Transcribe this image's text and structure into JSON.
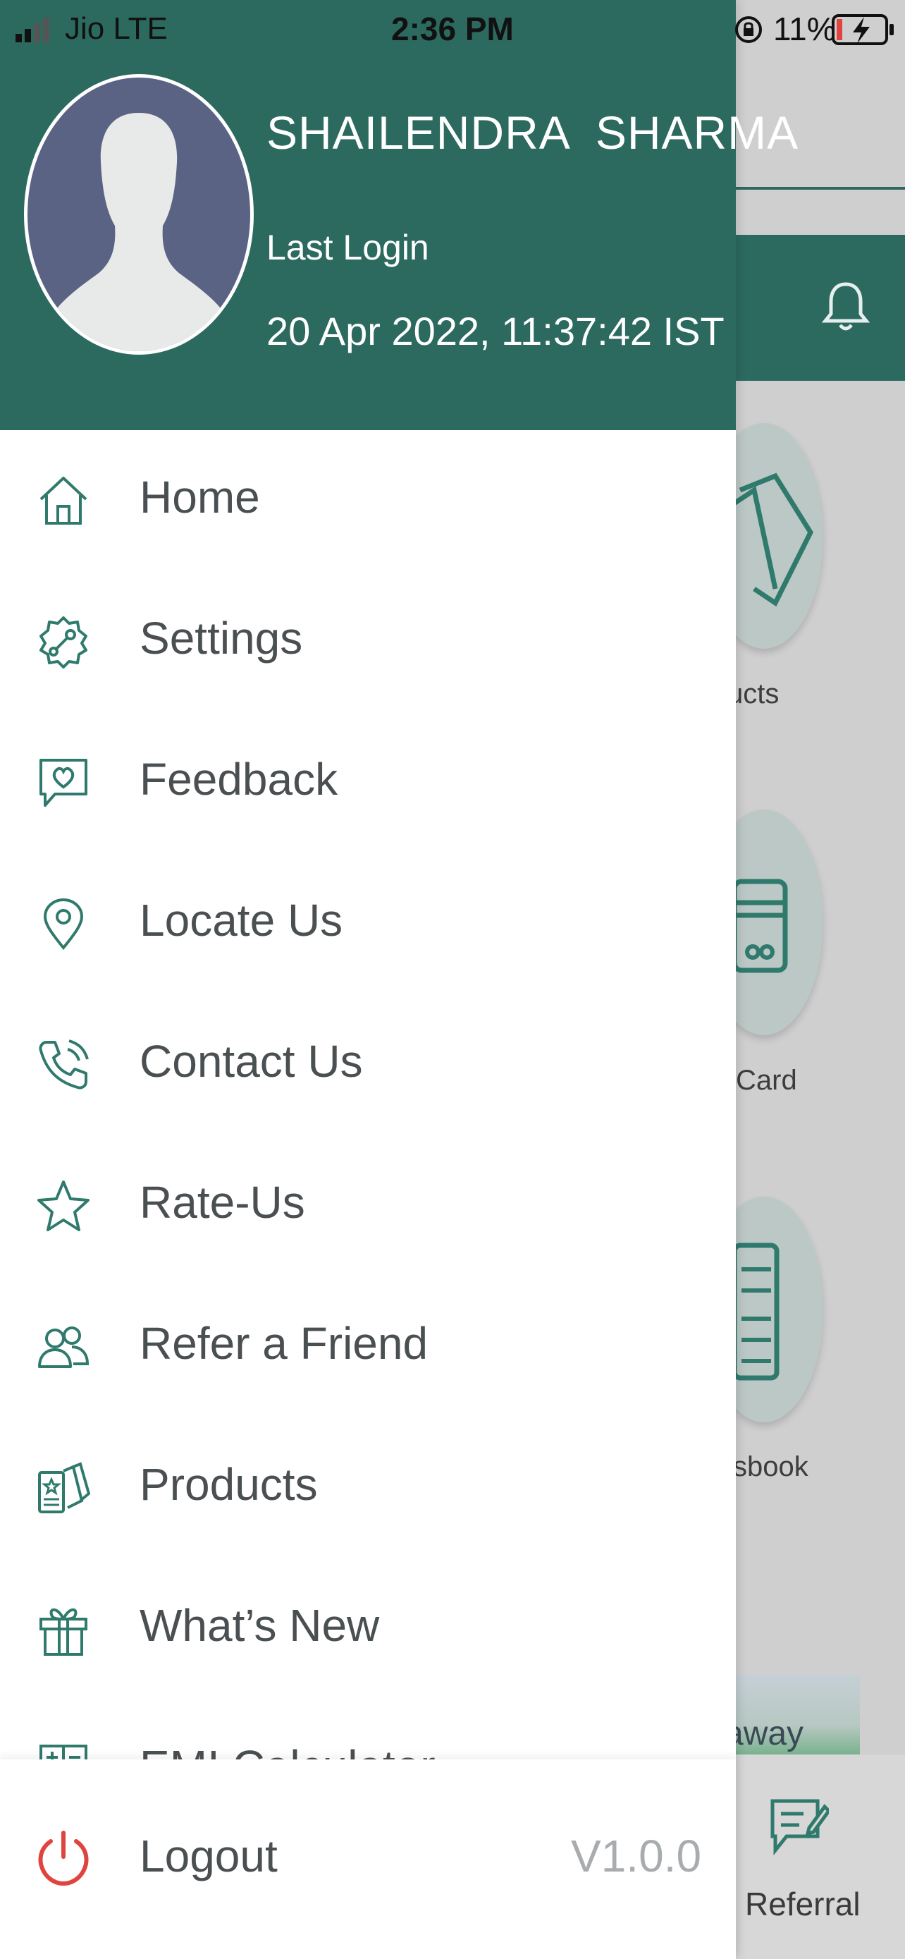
{
  "status_bar": {
    "carrier": "Jio  LTE",
    "time": "2:36 PM",
    "battery": "11%"
  },
  "profile": {
    "name": "SHAILENDRA  SHARMA",
    "last_login_label": "Last Login",
    "last_login_value": "20 Apr 2022, 11:37:42 IST"
  },
  "menu": {
    "items": [
      {
        "label": "Home",
        "icon": "home-icon"
      },
      {
        "label": "Settings",
        "icon": "settings-gear-icon"
      },
      {
        "label": "Feedback",
        "icon": "feedback-heart-icon"
      },
      {
        "label": "Locate Us",
        "icon": "location-pin-icon"
      },
      {
        "label": "Contact Us",
        "icon": "phone-icon"
      },
      {
        "label": "Rate-Us",
        "icon": "star-icon"
      },
      {
        "label": "Refer a Friend",
        "icon": "users-icon"
      },
      {
        "label": "Products",
        "icon": "products-cards-icon"
      },
      {
        "label": "What’s New",
        "icon": "gift-icon"
      },
      {
        "label": "EMI Calculator",
        "icon": "calculator-icon"
      }
    ]
  },
  "footer": {
    "logout_label": "Logout",
    "version": "V1.0.0"
  },
  "background": {
    "tile_labels": [
      "ucts",
      "Card",
      "sbook"
    ],
    "promo_text": "away",
    "nav_label": "Referral"
  },
  "colors": {
    "header_green": "#2c6a60",
    "icon_green": "#2f7a6c",
    "logout_red": "#e0443e",
    "menu_text": "#4a4f52"
  }
}
